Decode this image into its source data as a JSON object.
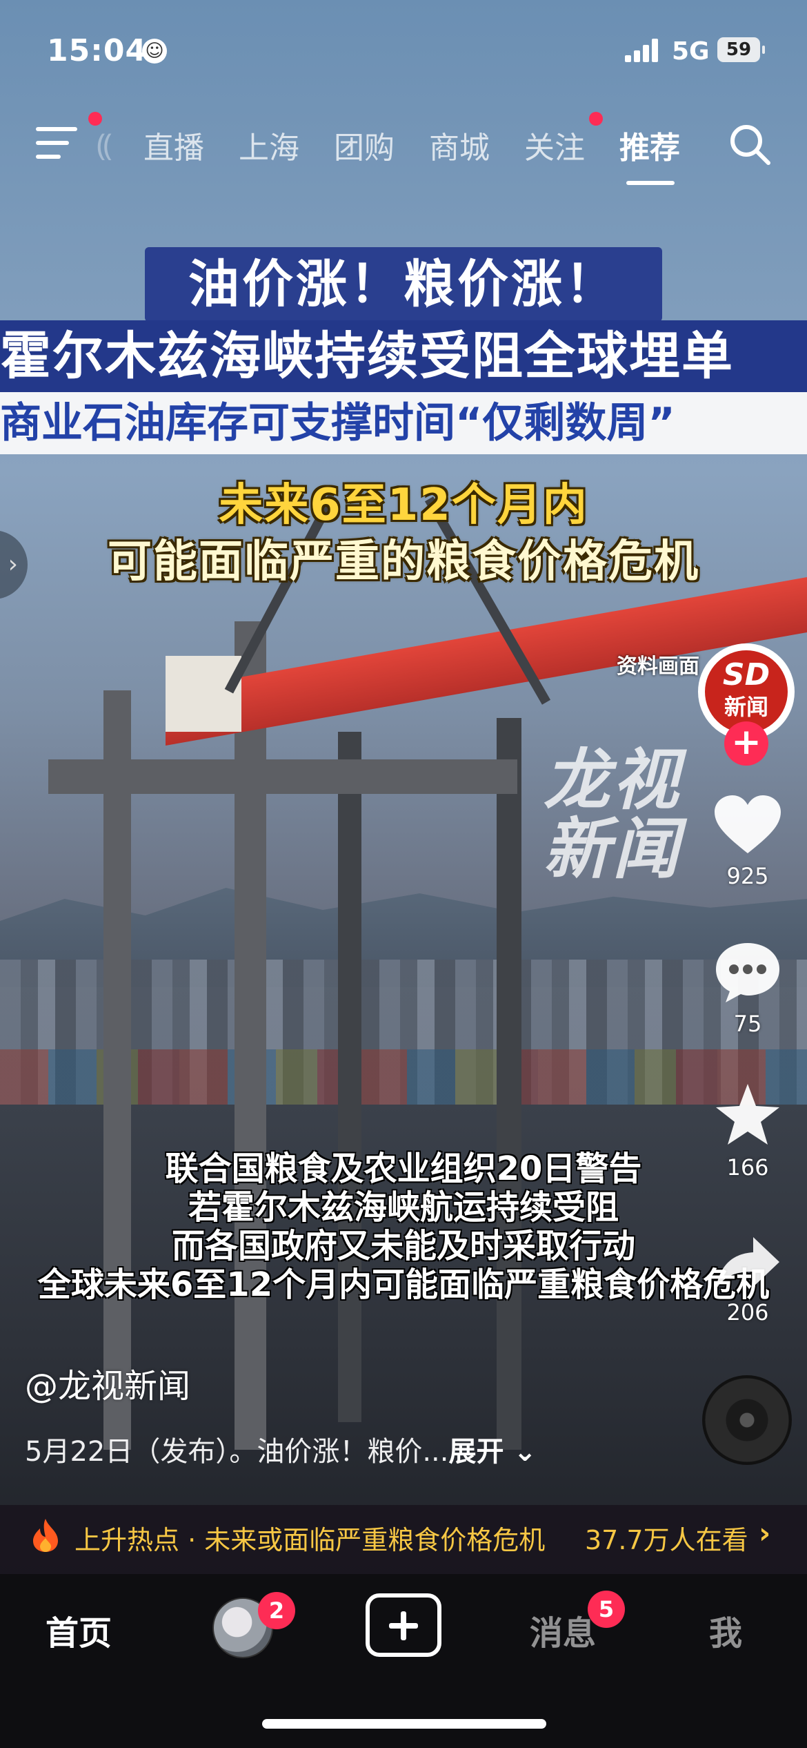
{
  "status_bar": {
    "time": "15:04",
    "network": "5G",
    "battery": "59"
  },
  "top_nav": {
    "tabs": [
      {
        "label": "直播",
        "has_dot": false
      },
      {
        "label": "上海",
        "has_dot": false
      },
      {
        "label": "团购",
        "has_dot": false
      },
      {
        "label": "商城",
        "has_dot": false
      },
      {
        "label": "关注",
        "has_dot": true
      },
      {
        "label": "推荐",
        "has_dot": false,
        "active": true
      }
    ]
  },
  "video": {
    "headline_1": "油价涨！粮价涨！",
    "headline_2": "霍尔木兹海峡持续受阻全球埋单",
    "headline_3": "商业石油库存可支撑时间“仅剩数周”",
    "highlight_1": "未来6至12个月内",
    "highlight_2": "可能面临严重的粮食价格危机",
    "source_tag": "资料画面",
    "watermark": [
      "龙视",
      "新闻"
    ],
    "subtitles": [
      "联合国粮食及农业组织20日警告",
      "若霍尔木兹海峡航运持续受阻",
      "而各国政府又未能及时采取行动",
      "全球未来6至12个月内可能面临严重粮食价格危机"
    ]
  },
  "sidebar": {
    "avatar_text": "新闻",
    "likes": "925",
    "comments": "75",
    "favorites": "166",
    "shares": "206"
  },
  "post": {
    "author": "@龙视新闻",
    "description": "5月22日（发布）。油价涨！粮价...",
    "expand_label": "展开"
  },
  "hot_bar": {
    "text": "上升热点 · 未来或面临严重粮食价格危机",
    "viewers": "37.7万人在看"
  },
  "bottom_nav": {
    "home": "首页",
    "friends_badge": "2",
    "messages": "消息",
    "messages_badge": "5",
    "me": "我"
  },
  "colors": {
    "accent": "#fe2c55",
    "hot": "#f7c744",
    "headline_blue": "#23388a",
    "highlight_yellow": "#ffd53d"
  }
}
